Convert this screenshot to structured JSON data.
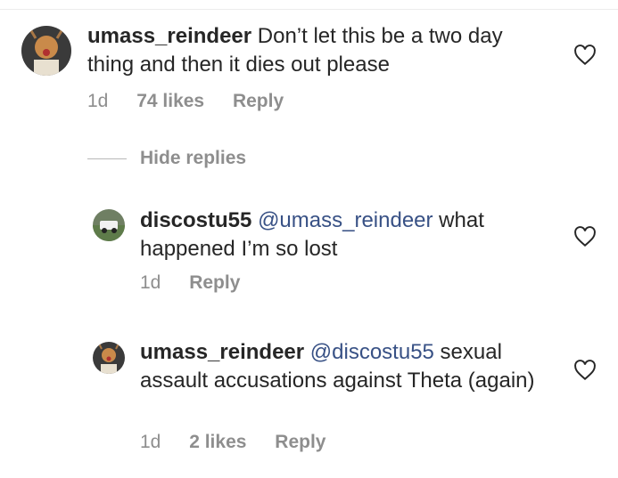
{
  "comments": [
    {
      "username": "umass_reindeer",
      "text": " Don’t let this be a two day thing and then it dies out please",
      "time": "1d",
      "likes": "74 likes",
      "reply": "Reply"
    }
  ],
  "hide_replies": "Hide replies",
  "replies": [
    {
      "username": "discostu55",
      "mention": "@umass_reindeer",
      "text": " what happened I’m so lost",
      "time": "1d",
      "reply": "Reply"
    },
    {
      "username": "umass_reindeer",
      "mention": "@discostu55",
      "text": " sexual assault accusations against Theta (again)",
      "time": "1d",
      "likes": "2 likes",
      "reply": "Reply"
    }
  ],
  "icons": {
    "like": "heart-icon",
    "avatar1": "reindeer-avatar",
    "avatar2": "car-photo-avatar"
  },
  "colors": {
    "text": "#262626",
    "meta": "#8e8e8e",
    "mention": "#385185"
  }
}
